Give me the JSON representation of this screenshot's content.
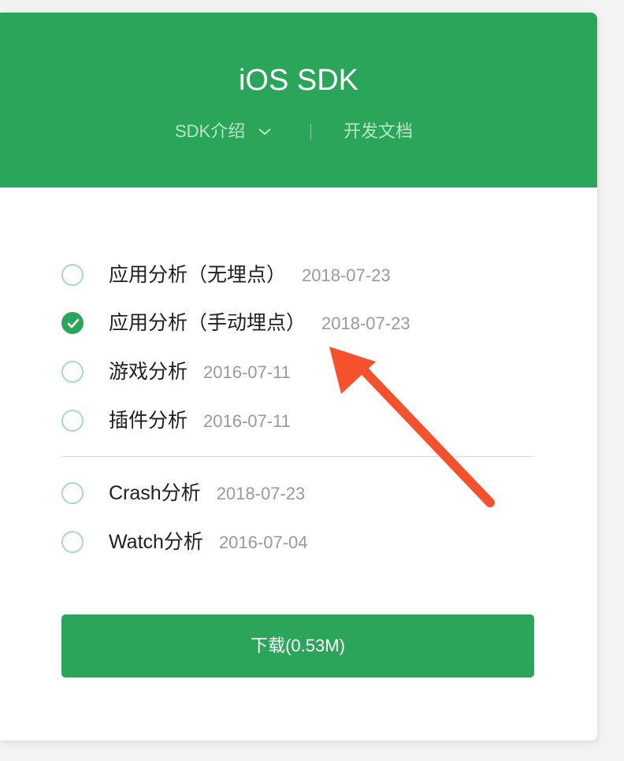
{
  "header": {
    "title": "iOS SDK",
    "nav_intro": "SDK介绍",
    "nav_docs": "开发文档"
  },
  "options": [
    {
      "name": "应用分析（无埋点）",
      "date": "2018-07-23",
      "checked": false
    },
    {
      "name": "应用分析（手动埋点）",
      "date": "2018-07-23",
      "checked": true
    },
    {
      "name": "游戏分析",
      "date": "2016-07-11",
      "checked": false
    },
    {
      "name": "插件分析",
      "date": "2016-07-11",
      "checked": false
    },
    {
      "name": "Crash分析",
      "date": "2018-07-23",
      "checked": false
    },
    {
      "name": "Watch分析",
      "date": "2016-07-04",
      "checked": false
    }
  ],
  "download": {
    "label": "下载(0.53M)"
  },
  "colors": {
    "brand_green": "#2aa55a",
    "radio_border": "#a6dcbb",
    "annotation_arrow": "#f4512c"
  },
  "icons": {
    "chevron": "chevron-down-icon",
    "check": "check-icon",
    "arrow": "arrow-annotation"
  }
}
